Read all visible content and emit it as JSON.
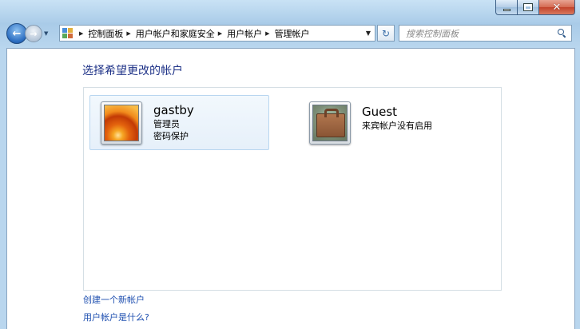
{
  "window": {
    "caption_min_icon": "minimize-icon",
    "caption_max_icon": "maximize-icon",
    "caption_close_icon": "close-icon"
  },
  "nav": {
    "breadcrumbs": [
      "控制面板",
      "用户帐户和家庭安全",
      "用户帐户",
      "管理帐户"
    ],
    "search_placeholder": "搜索控制面板"
  },
  "main": {
    "title": "选择希望更改的帐户",
    "accounts": [
      {
        "name": "gastby",
        "line1": "管理员",
        "line2": "密码保护",
        "picture": "flower-picture",
        "selected": true
      },
      {
        "name": "Guest",
        "line1": "来宾帐户没有启用",
        "line2": "",
        "picture": "briefcase-picture",
        "selected": false
      }
    ],
    "links": {
      "create": "创建一个新帐户",
      "what_is": "用户帐户是什么?"
    }
  },
  "colors": {
    "title": "#1e3287",
    "link": "#1e4fb0",
    "selection_bg": "#e6f0fa"
  }
}
